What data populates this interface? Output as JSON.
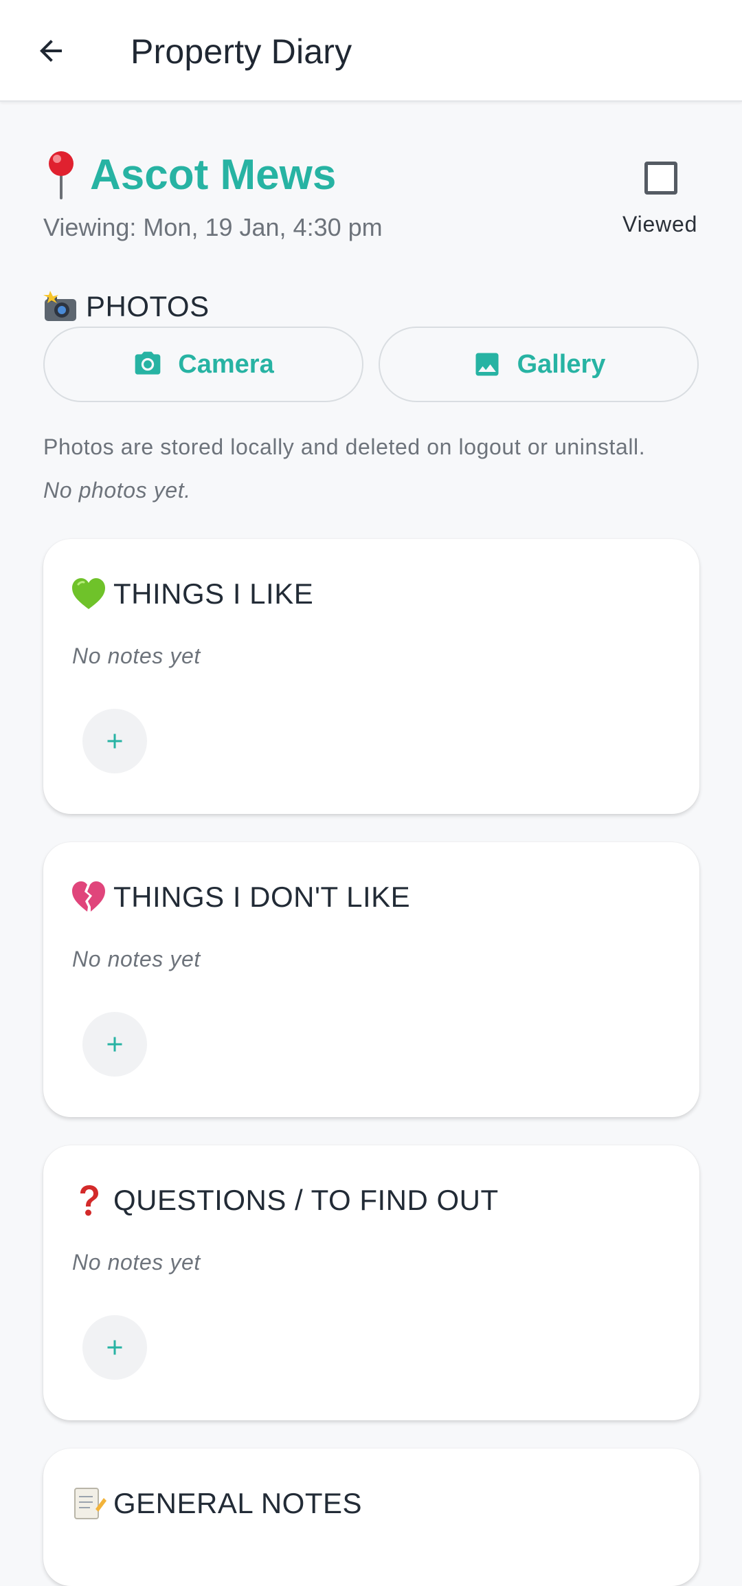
{
  "app_bar": {
    "title": "Property Diary",
    "back_icon": "arrow-back-icon"
  },
  "property": {
    "name": "Ascot Mews",
    "viewing": "Viewing: Mon, 19 Jan, 4:30 pm",
    "viewed_label": "Viewed",
    "viewed_checked": false
  },
  "photos": {
    "heading": "PHOTOS",
    "camera_label": "Camera",
    "gallery_label": "Gallery",
    "storage_note": "Photos are stored locally and deleted on logout or uninstall.",
    "empty_text": "No photos yet."
  },
  "sections": [
    {
      "title": "THINGS I LIKE",
      "icon": "green-heart-icon",
      "empty_text": "No notes yet"
    },
    {
      "title": "THINGS I DON'T LIKE",
      "icon": "broken-heart-icon",
      "empty_text": "No notes yet"
    },
    {
      "title": "QUESTIONS / TO FIND OUT",
      "icon": "question-mark-icon",
      "empty_text": "No notes yet"
    },
    {
      "title": "GENERAL NOTES",
      "icon": "memo-icon"
    }
  ],
  "colors": {
    "accent": "#27b3a3",
    "text": "#222b36",
    "muted": "#6d737b",
    "background": "#f7f8fa"
  }
}
